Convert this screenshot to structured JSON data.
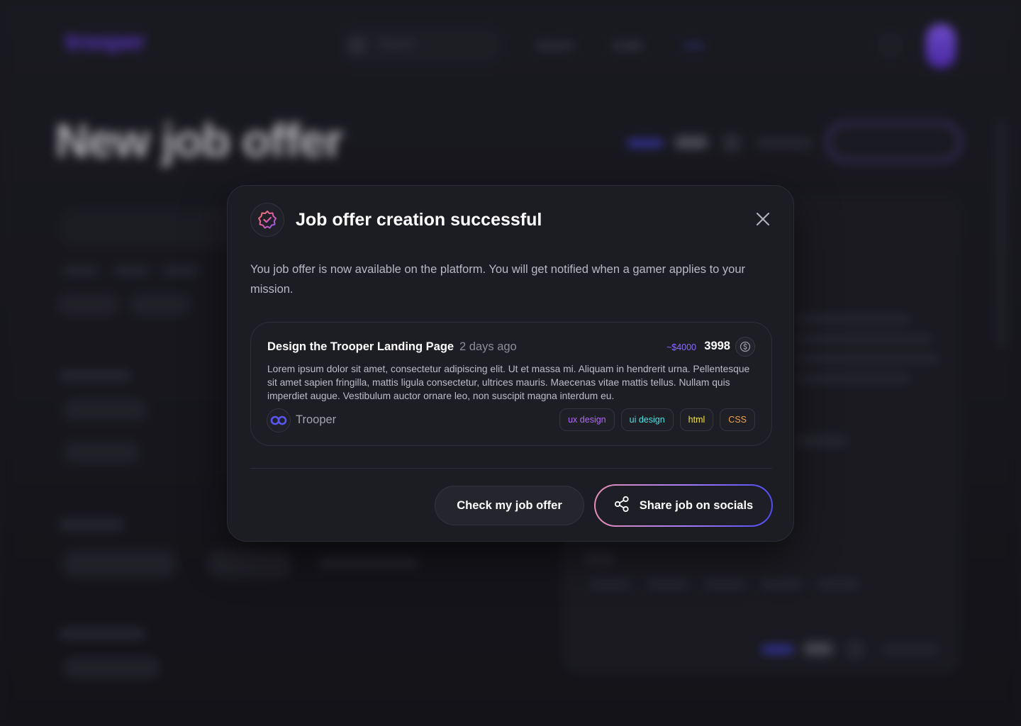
{
  "background": {
    "logo": "trooper",
    "search_placeholder": "Search",
    "nav": [
      "Gamers",
      "Guilds",
      "Jobs"
    ],
    "page_title": "New job offer",
    "create_button": "Create a recruit"
  },
  "modal": {
    "badge_icon": "verified-badge-icon",
    "title": "Job offer creation successful",
    "close_icon": "close-icon",
    "description": "You job offer is now available on the platform. You will get notified when a gamer applies to your mission.",
    "job": {
      "title": "Design the Trooper Landing Page",
      "time_ago": "2 days ago",
      "price_estimate": "~$4000",
      "price": "3998",
      "coin_icon": "dollar-coin-icon",
      "description": "Lorem ipsum dolor sit amet, consectetur adipiscing elit. Ut et massa mi. Aliquam in hendrerit urna. Pellentesque sit amet sapien fringilla, mattis ligula consectetur, ultrices mauris. Maecenas vitae mattis tellus. Nullam quis imperdiet augue. Vestibulum auctor ornare leo, non suscipit magna interdum eu.",
      "company": "Trooper",
      "company_logo_icon": "trooper-logo-icon",
      "tags": [
        {
          "label": "ux design",
          "color": "#b06cf5"
        },
        {
          "label": "ui design",
          "color": "#4ce3e6"
        },
        {
          "label": "html",
          "color": "#f2e34a"
        },
        {
          "label": "CSS",
          "color": "#f0a04a"
        }
      ]
    },
    "buttons": {
      "check": "Check my job offer",
      "share": "Share job on socials",
      "share_icon": "share-icon"
    }
  }
}
